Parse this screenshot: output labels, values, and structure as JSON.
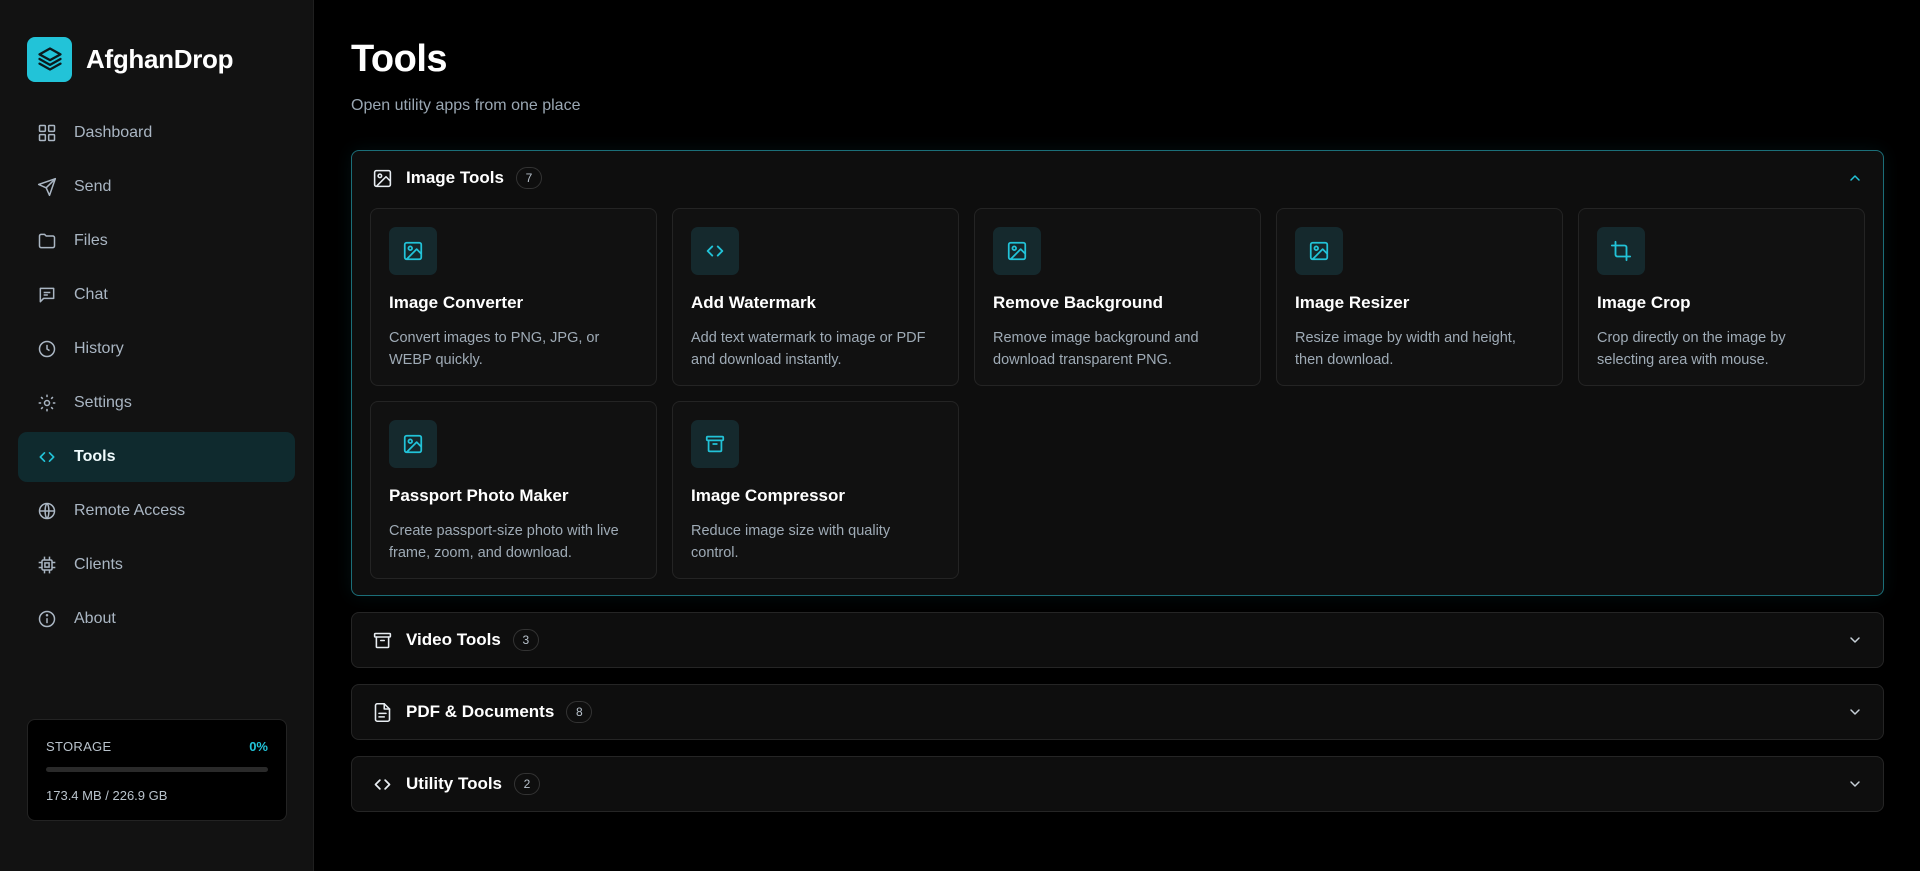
{
  "brand": {
    "name": "AfghanDrop",
    "logo_icon": "layers-icon",
    "accent": "#22c3d8"
  },
  "sidebar": {
    "items": [
      {
        "label": "Dashboard",
        "icon": "grid-icon",
        "active": false
      },
      {
        "label": "Send",
        "icon": "send-icon",
        "active": false
      },
      {
        "label": "Files",
        "icon": "folder-icon",
        "active": false
      },
      {
        "label": "Chat",
        "icon": "chat-icon",
        "active": false
      },
      {
        "label": "History",
        "icon": "clock-icon",
        "active": false
      },
      {
        "label": "Settings",
        "icon": "gear-icon",
        "active": false
      },
      {
        "label": "Tools",
        "icon": "code-icon",
        "active": true
      },
      {
        "label": "Remote Access",
        "icon": "globe-icon",
        "active": false
      },
      {
        "label": "Clients",
        "icon": "chip-icon",
        "active": false
      },
      {
        "label": "About",
        "icon": "info-icon",
        "active": false
      }
    ],
    "storage": {
      "title": "STORAGE",
      "percent_label": "0%",
      "used_fraction": 0.0,
      "usage_text": "173.4 MB / 226.9 GB"
    }
  },
  "main": {
    "title": "Tools",
    "subtitle": "Open utility apps from one place",
    "sections": [
      {
        "title": "Image Tools",
        "count": "7",
        "icon": "image-icon",
        "expanded": true,
        "tools": [
          {
            "title": "Image Converter",
            "desc": "Convert images to PNG, JPG, or WEBP quickly.",
            "icon": "image-icon"
          },
          {
            "title": "Add Watermark",
            "desc": "Add text watermark to image or PDF and download instantly.",
            "icon": "code-icon"
          },
          {
            "title": "Remove Background",
            "desc": "Remove image background and download transparent PNG.",
            "icon": "image-icon"
          },
          {
            "title": "Image Resizer",
            "desc": "Resize image by width and height, then download.",
            "icon": "image-icon"
          },
          {
            "title": "Image Crop",
            "desc": "Crop directly on the image by selecting area with mouse.",
            "icon": "crop-icon"
          },
          {
            "title": "Passport Photo Maker",
            "desc": "Create passport-size photo with live frame, zoom, and download.",
            "icon": "image-icon"
          },
          {
            "title": "Image Compressor",
            "desc": "Reduce image size with quality control.",
            "icon": "archive-icon"
          }
        ]
      },
      {
        "title": "Video Tools",
        "count": "3",
        "icon": "archive-icon",
        "expanded": false
      },
      {
        "title": "PDF & Documents",
        "count": "8",
        "icon": "document-icon",
        "expanded": false
      },
      {
        "title": "Utility Tools",
        "count": "2",
        "icon": "code-icon",
        "expanded": false
      }
    ]
  }
}
